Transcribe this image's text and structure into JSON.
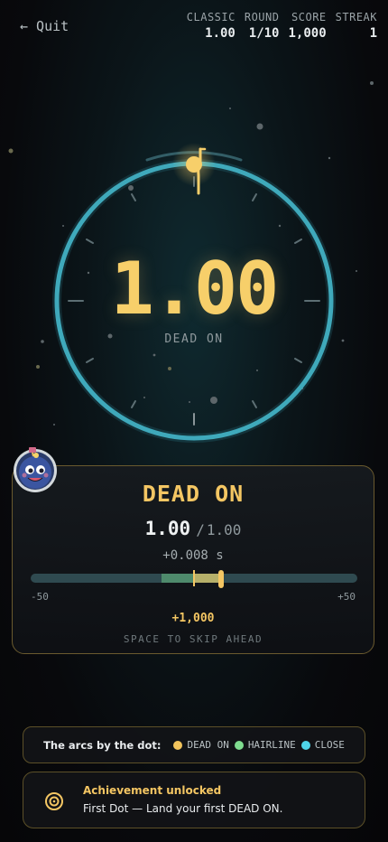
{
  "nav": {
    "quit_label": "← Quit"
  },
  "stats": {
    "mode": {
      "label": "CLASSIC",
      "value": "1.00"
    },
    "round": {
      "label": "ROUND",
      "value": "1/10"
    },
    "score": {
      "label": "SCORE",
      "value": "1,000"
    },
    "streak": {
      "label": "STREAK",
      "value": "1"
    }
  },
  "dial": {
    "value": "1.00",
    "caption": "DEAD ON"
  },
  "result": {
    "title": "DEAD ON",
    "stopped": "1.00",
    "separator": "/",
    "target": "1.00",
    "delta": "+0.008 s",
    "scale_min": "-50",
    "scale_max": "+50",
    "points": "+1,000",
    "hint": "SPACE TO SKIP AHEAD"
  },
  "legend": {
    "title": "The arcs by the dot:",
    "items": [
      {
        "label": "DEAD ON",
        "color": "#f2c45c"
      },
      {
        "label": "HAIRLINE",
        "color": "#7fdc8f"
      },
      {
        "label": "CLOSE",
        "color": "#4fd4e8"
      }
    ]
  },
  "achievement": {
    "title": "Achievement unlocked",
    "description": "First Dot — Land your first DEAD ON.",
    "icon": "target-icon"
  },
  "colors": {
    "accent": "#f4c663",
    "ring": "#3ea6b8",
    "panel_border": "#6a5a2e"
  }
}
